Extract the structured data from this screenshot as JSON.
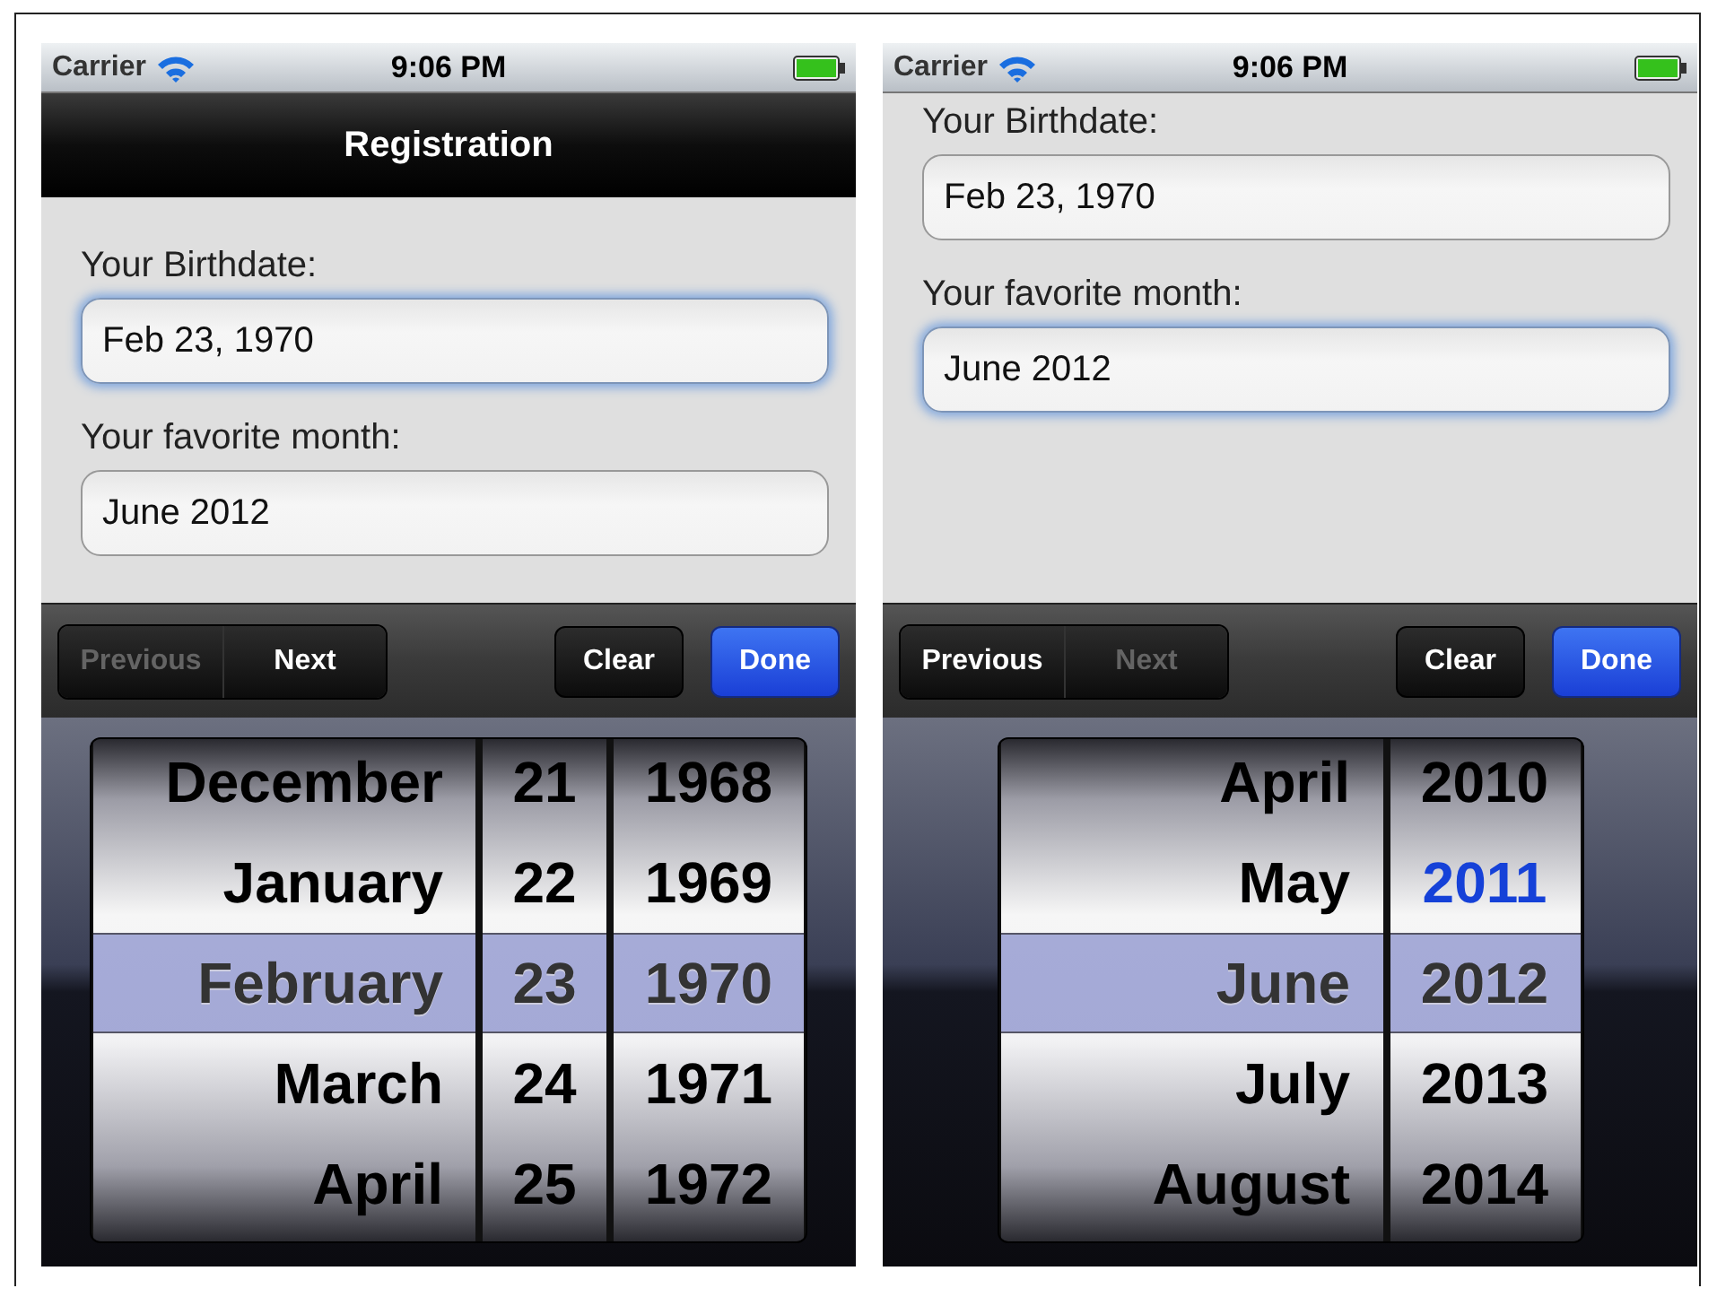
{
  "screens": [
    {
      "status_bar": {
        "carrier": "Carrier",
        "time": "9:06 PM"
      },
      "nav_bar": {
        "title": "Registration"
      },
      "form": {
        "fields": [
          {
            "label": "Your Birthdate:",
            "value": "Feb 23, 1970",
            "focused": true
          },
          {
            "label": "Your favorite month:",
            "value": "June 2012",
            "focused": false
          }
        ]
      },
      "toolbar": {
        "segments": [
          {
            "label": "Previous",
            "disabled": true
          },
          {
            "label": "Next",
            "disabled": false
          }
        ],
        "buttons": [
          {
            "label": "Clear",
            "kind": "plain"
          },
          {
            "label": "Done",
            "kind": "primary"
          }
        ]
      },
      "picker": {
        "columns": [
          {
            "kind": "month",
            "items": [
              {
                "text": "December",
                "selected": false,
                "current": false
              },
              {
                "text": "January",
                "selected": false,
                "current": false
              },
              {
                "text": "February",
                "selected": true,
                "current": false
              },
              {
                "text": "March",
                "selected": false,
                "current": false
              },
              {
                "text": "April",
                "selected": false,
                "current": false
              }
            ]
          },
          {
            "kind": "day",
            "items": [
              {
                "text": "21",
                "selected": false,
                "current": false
              },
              {
                "text": "22",
                "selected": false,
                "current": false
              },
              {
                "text": "23",
                "selected": true,
                "current": false
              },
              {
                "text": "24",
                "selected": false,
                "current": false
              },
              {
                "text": "25",
                "selected": false,
                "current": false
              }
            ]
          },
          {
            "kind": "year",
            "items": [
              {
                "text": "1968",
                "selected": false,
                "current": false
              },
              {
                "text": "1969",
                "selected": false,
                "current": false
              },
              {
                "text": "1970",
                "selected": true,
                "current": false
              },
              {
                "text": "1971",
                "selected": false,
                "current": false
              },
              {
                "text": "1972",
                "selected": false,
                "current": false
              }
            ]
          }
        ]
      }
    },
    {
      "status_bar": {
        "carrier": "Carrier",
        "time": "9:06 PM"
      },
      "form": {
        "fields": [
          {
            "label": "Your Birthdate:",
            "value": "Feb 23, 1970",
            "focused": false
          },
          {
            "label": "Your favorite month:",
            "value": "June 2012",
            "focused": true
          }
        ]
      },
      "toolbar": {
        "segments": [
          {
            "label": "Previous",
            "disabled": false
          },
          {
            "label": "Next",
            "disabled": true
          }
        ],
        "buttons": [
          {
            "label": "Clear",
            "kind": "plain"
          },
          {
            "label": "Done",
            "kind": "primary"
          }
        ]
      },
      "picker": {
        "columns": [
          {
            "kind": "month",
            "items": [
              {
                "text": "April",
                "selected": false,
                "current": false
              },
              {
                "text": "May",
                "selected": false,
                "current": false
              },
              {
                "text": "June",
                "selected": true,
                "current": false
              },
              {
                "text": "July",
                "selected": false,
                "current": false
              },
              {
                "text": "August",
                "selected": false,
                "current": false
              }
            ]
          },
          {
            "kind": "year",
            "items": [
              {
                "text": "2010",
                "selected": false,
                "current": false
              },
              {
                "text": "2011",
                "selected": false,
                "current": true
              },
              {
                "text": "2012",
                "selected": true,
                "current": false
              },
              {
                "text": "2013",
                "selected": false,
                "current": false
              },
              {
                "text": "2014",
                "selected": false,
                "current": false
              }
            ]
          }
        ]
      }
    }
  ]
}
